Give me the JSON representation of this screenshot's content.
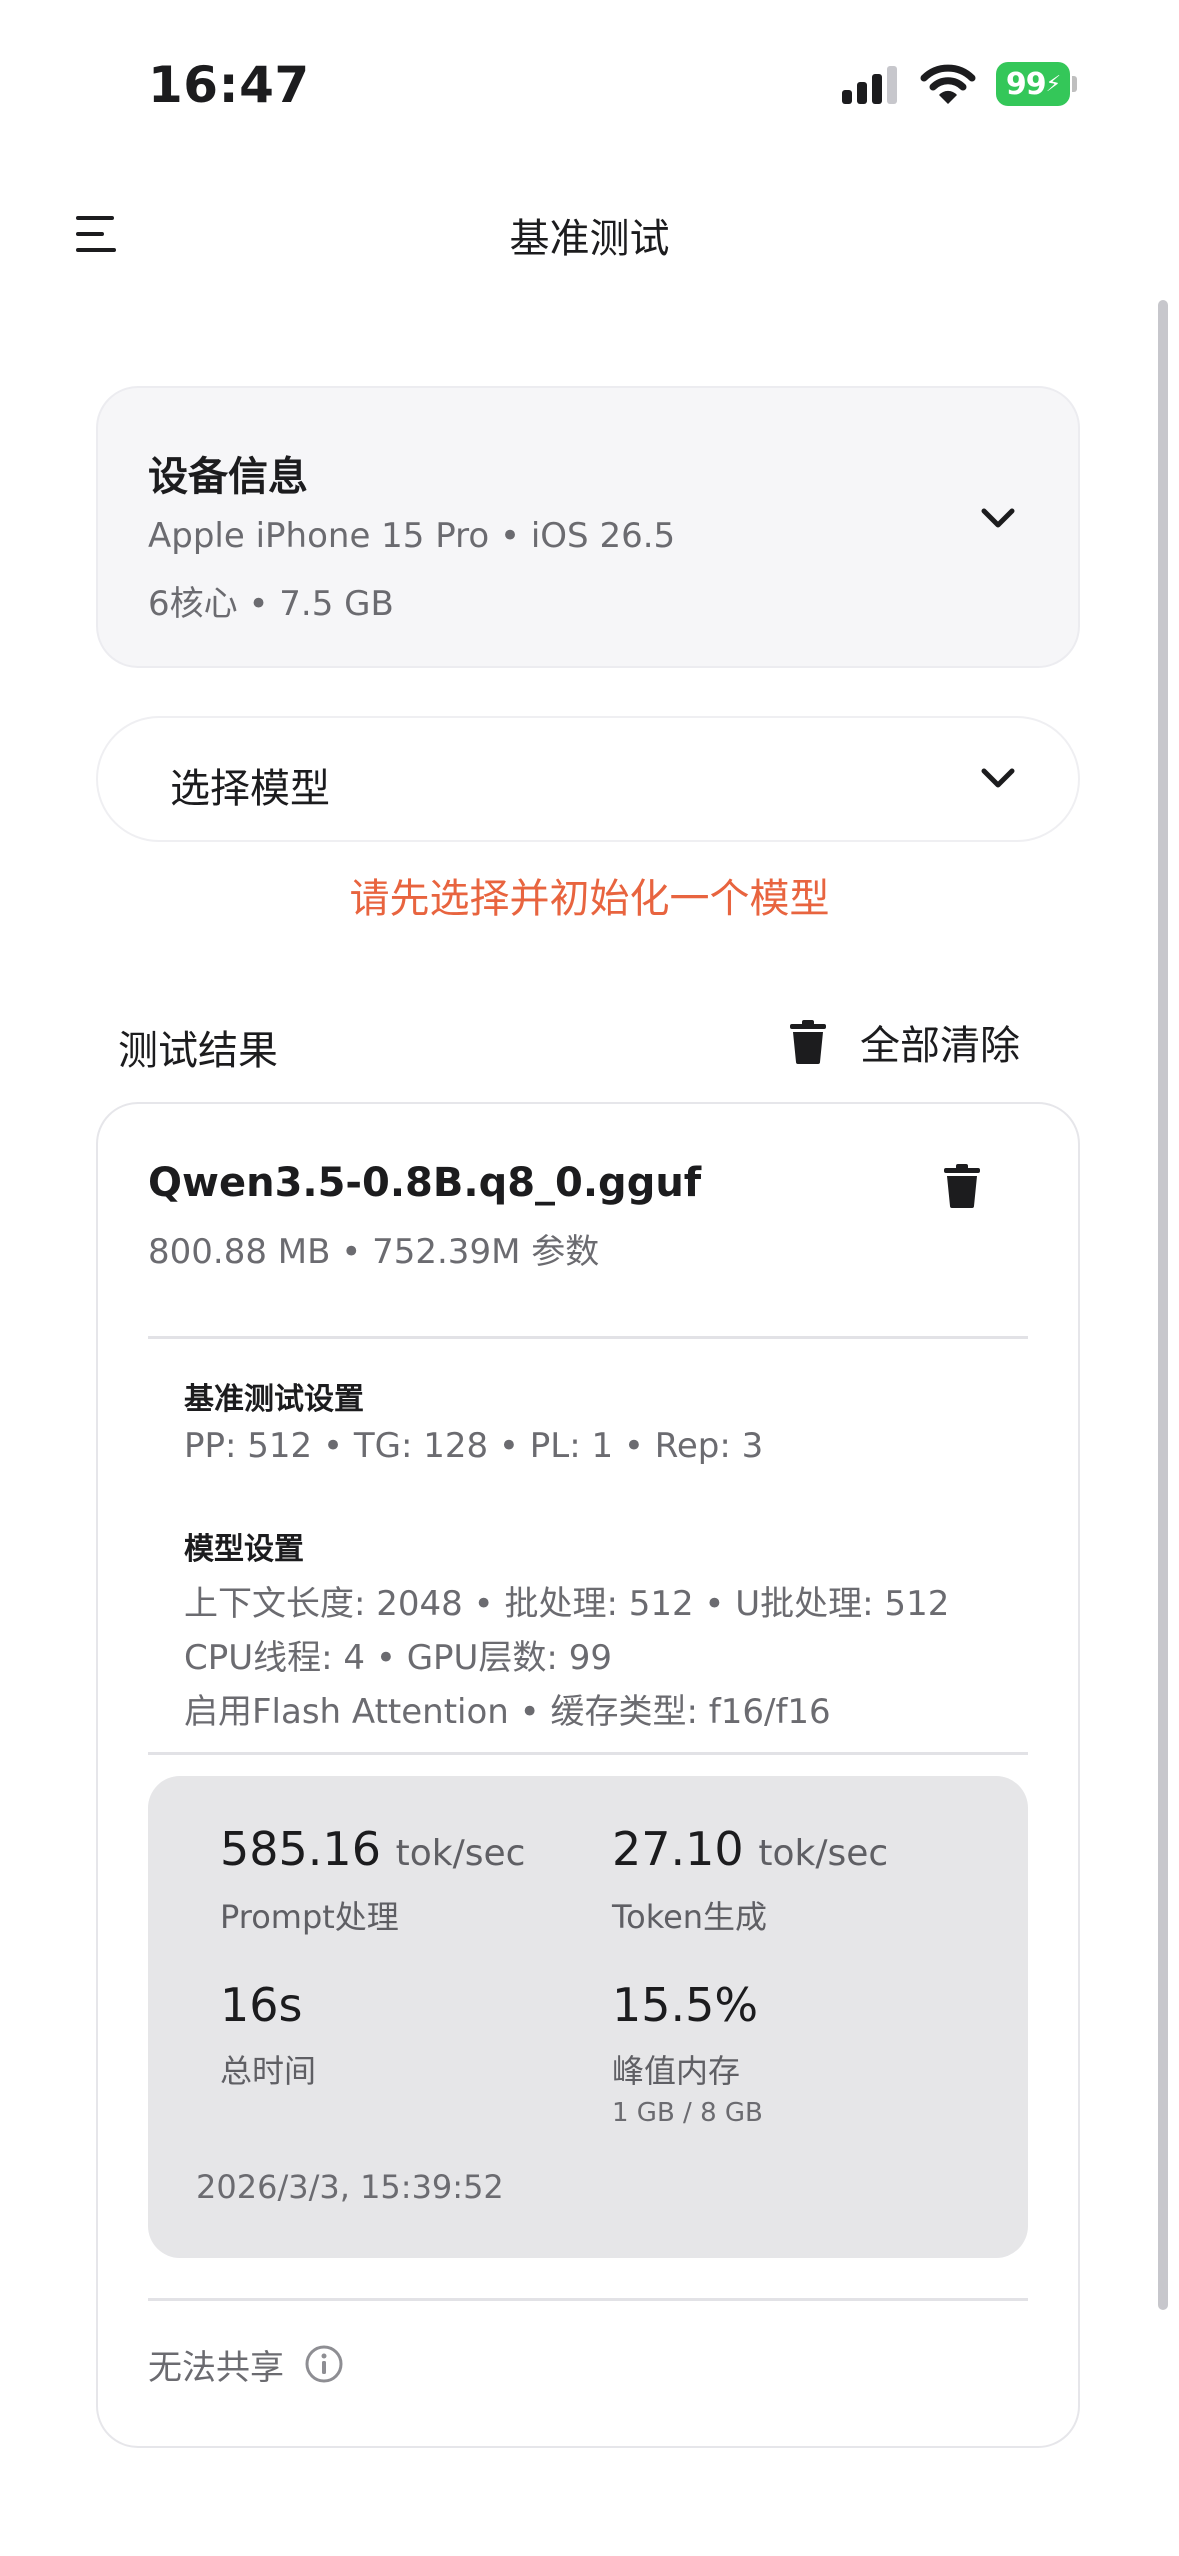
{
  "status_bar": {
    "time": "16:47",
    "battery": "99"
  },
  "nav": {
    "title": "基准测试"
  },
  "device": {
    "title": "设备信息",
    "line1": "Apple iPhone 15 Pro • iOS 26.5",
    "line2": "6核心 • 7.5 GB"
  },
  "model_select": {
    "label": "选择模型"
  },
  "warning": "请先选择并初始化一个模型",
  "results": {
    "title": "测试结果",
    "clear_all": "全部清除"
  },
  "result": {
    "model_name": "Qwen3.5-0.8B.q8_0.gguf",
    "meta": "800.88 MB • 752.39M 参数",
    "bench_settings_title": "基准测试设置",
    "bench_settings": "PP: 512 • TG: 128 • PL: 1 • Rep: 3",
    "model_settings_title": "模型设置",
    "model_settings_line1": "上下文长度: 2048 • 批处理: 512 • U批处理: 512",
    "model_settings_line2": "CPU线程: 4 • GPU层数: 99",
    "model_settings_line3": "启用Flash Attention • 缓存类型: f16/f16",
    "metrics": {
      "pp_value": "585.16",
      "pp_unit": "tok/sec",
      "pp_label": "Prompt处理",
      "tg_value": "27.10",
      "tg_unit": "tok/sec",
      "tg_label": "Token生成",
      "total_time_value": "16s",
      "total_time_label": "总时间",
      "peak_mem_value": "15.5%",
      "peak_mem_label": "峰值内存",
      "peak_mem_detail": "1 GB / 8 GB"
    },
    "timestamp": "2026/3/3, 15:39:52",
    "share_label": "无法共享"
  },
  "colors": {
    "warning": "#e8643f",
    "battery": "#34c759",
    "metrics_bg": "#e6e6e8"
  },
  "icons": [
    "menu-icon",
    "chevron-down-icon",
    "trash-icon",
    "info-icon",
    "signal-icon",
    "wifi-icon",
    "battery-icon"
  ]
}
